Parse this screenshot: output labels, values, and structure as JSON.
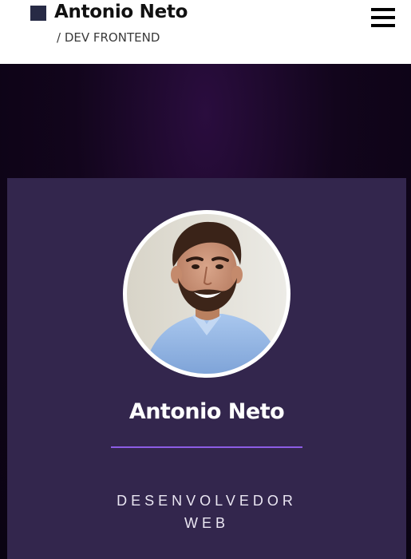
{
  "header": {
    "brand_name": "Antonio Neto",
    "tagline": "/ DEV FRONTEND",
    "menu_icon": "hamburger-menu-icon"
  },
  "profile": {
    "name": "Antonio Neto",
    "role_line_1": "DESENVOLVEDOR",
    "role_line_2": "WEB",
    "photo_alt": "Antonio Neto"
  },
  "colors": {
    "brand_square": "#272a45",
    "hero_background": "#12051c",
    "card_background": "#33264d",
    "divider_accent": "#8c5ce4"
  }
}
